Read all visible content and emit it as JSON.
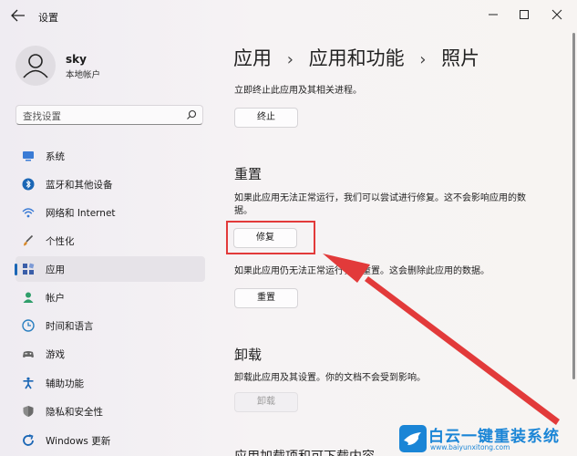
{
  "window": {
    "title": "设置",
    "controls": [
      "minimize",
      "maximize",
      "close"
    ]
  },
  "user": {
    "name": "sky",
    "account_type": "本地帐户"
  },
  "search": {
    "placeholder": "查找设置"
  },
  "sidebar": {
    "items": [
      {
        "label": "系统",
        "icon": "monitor-icon",
        "color": "#3a7bd5"
      },
      {
        "label": "蓝牙和其他设备",
        "icon": "bluetooth-icon",
        "color": "#1a66b5"
      },
      {
        "label": "网络和 Internet",
        "icon": "wifi-icon",
        "color": "#3a7bd5"
      },
      {
        "label": "个性化",
        "icon": "brush-icon",
        "color": "#555555"
      },
      {
        "label": "应用",
        "icon": "apps-icon",
        "color": "#3a5ea8",
        "active": true
      },
      {
        "label": "帐户",
        "icon": "account-icon",
        "color": "#2f9e6a"
      },
      {
        "label": "时间和语言",
        "icon": "globe-clock-icon",
        "color": "#2a7fc0"
      },
      {
        "label": "游戏",
        "icon": "gamepad-icon",
        "color": "#666666"
      },
      {
        "label": "辅助功能",
        "icon": "accessibility-icon",
        "color": "#1a66b5"
      },
      {
        "label": "隐私和安全性",
        "icon": "shield-icon",
        "color": "#7a7a7a"
      },
      {
        "label": "Windows 更新",
        "icon": "update-icon",
        "color": "#1a66b5"
      }
    ]
  },
  "breadcrumb": [
    "应用",
    "应用和功能",
    "照片"
  ],
  "content": {
    "terminate_desc": "立即终止此应用及其相关进程。",
    "terminate_button": "终止",
    "reset_heading": "重置",
    "repair_desc_line1": "如果此应用无法正常运行，我们可以尝试进行修复。这不会影响应用的数",
    "repair_desc_line2": "据。",
    "repair_button": "修复",
    "reset_desc": "如果此应用仍无法正常运行，请重置。这会删除此应用的数据。",
    "reset_button": "重置",
    "uninstall_heading": "卸载",
    "uninstall_desc": "卸载此应用及其设置。你的文档不会受到影响。",
    "uninstall_button": "卸载",
    "next_section_partial": "应用加载项和可下载内容"
  },
  "annotation": {
    "highlight_color": "#e23a3a",
    "arrow_color": "#e23a3a"
  },
  "watermark": {
    "main": "白云一键重装系统",
    "sub": "www.baiyunxitong.com"
  }
}
